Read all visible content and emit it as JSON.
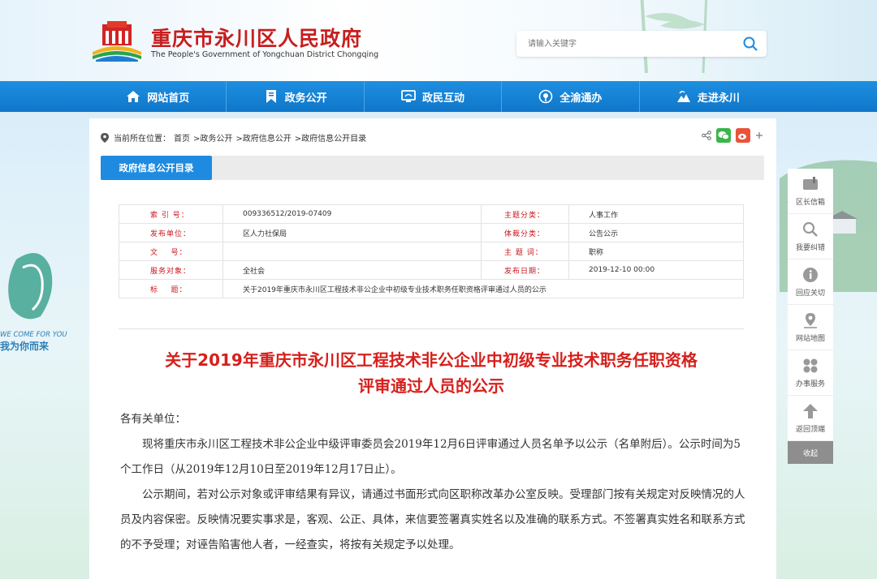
{
  "header": {
    "title": "重庆市永川区人民政府",
    "subtitle": "The People's Government of Yongchuan District Chongqing",
    "search_placeholder": "请输入关键字"
  },
  "nav": {
    "items": [
      {
        "label": "网站首页",
        "icon": "home-icon"
      },
      {
        "label": "政务公开",
        "icon": "bookmark-icon"
      },
      {
        "label": "政民互动",
        "icon": "monitor-icon"
      },
      {
        "label": "全渝通办",
        "icon": "location-icon"
      },
      {
        "label": "走进永川",
        "icon": "scenery-icon"
      }
    ]
  },
  "deco": {
    "welcome_en": "WE COME FOR YOU",
    "welcome_zh": "我为你而来"
  },
  "breadcrumb": {
    "prefix": "当前所在位置：",
    "items": [
      "首页",
      ">政务公开",
      ">政府信息公开",
      ">政府信息公开目录"
    ]
  },
  "tab": {
    "active_label": "政府信息公开目录"
  },
  "meta": {
    "rows": [
      {
        "k1": "索 引 号：",
        "v1": "009336512/2019-07409",
        "k2": "主题分类：",
        "v2": "人事工作"
      },
      {
        "k1": "发布单位：",
        "v1": "区人力社保局",
        "k2": "体裁分类：",
        "v2": "公告公示"
      },
      {
        "k1": "文    号：",
        "v1": "",
        "k2": "主 题 词：",
        "v2": "职称"
      },
      {
        "k1": "服务对象：",
        "v1": "全社会",
        "k2": "发布日期：",
        "v2": "2019-12-10 00:00"
      }
    ],
    "title_key": "标    题：",
    "title_value": "关于2019年重庆市永川区工程技术非公企业中初级专业技术职务任职资格评审通过人员的公示"
  },
  "article": {
    "title_line1": "关于2019年重庆市永川区工程技术非公企业中初级专业技术职务任职资格",
    "title_line2": "评审通过人员的公示",
    "salutation": "各有关单位：",
    "para1": "现将重庆市永川区工程技术非公企业中级评审委员会2019年12月6日评审通过人员名单予以公示（名单附后）。公示时间为5个工作日（从2019年12月10日至2019年12月17日止）。",
    "para2": "公示期间，若对公示对象或评审结果有异议，请通过书面形式向区职称改革办公室反映。受理部门按有关规定对反映情况的人员及内容保密。反映情况要实事求是，客观、公正、具体，来信要签署真实姓名以及准确的联系方式。不签署真实姓名和联系方式的不予受理；对诬告陷害他人者，一经查实，将按有关规定予以处理。"
  },
  "floatbar": {
    "items": [
      {
        "label": "区长信箱",
        "icon": "mailbox-icon"
      },
      {
        "label": "我要纠错",
        "icon": "search-error-icon"
      },
      {
        "label": "回应关切",
        "icon": "info-icon"
      },
      {
        "label": "网站地图",
        "icon": "map-pin-icon"
      },
      {
        "label": "办事服务",
        "icon": "service-grid-icon"
      },
      {
        "label": "返回顶端",
        "icon": "arrow-up-icon"
      }
    ],
    "close_label": "收起"
  },
  "colors": {
    "nav_blue": "#0f76c9",
    "accent_red": "#d6201c",
    "tab_blue": "#1e8be0"
  }
}
